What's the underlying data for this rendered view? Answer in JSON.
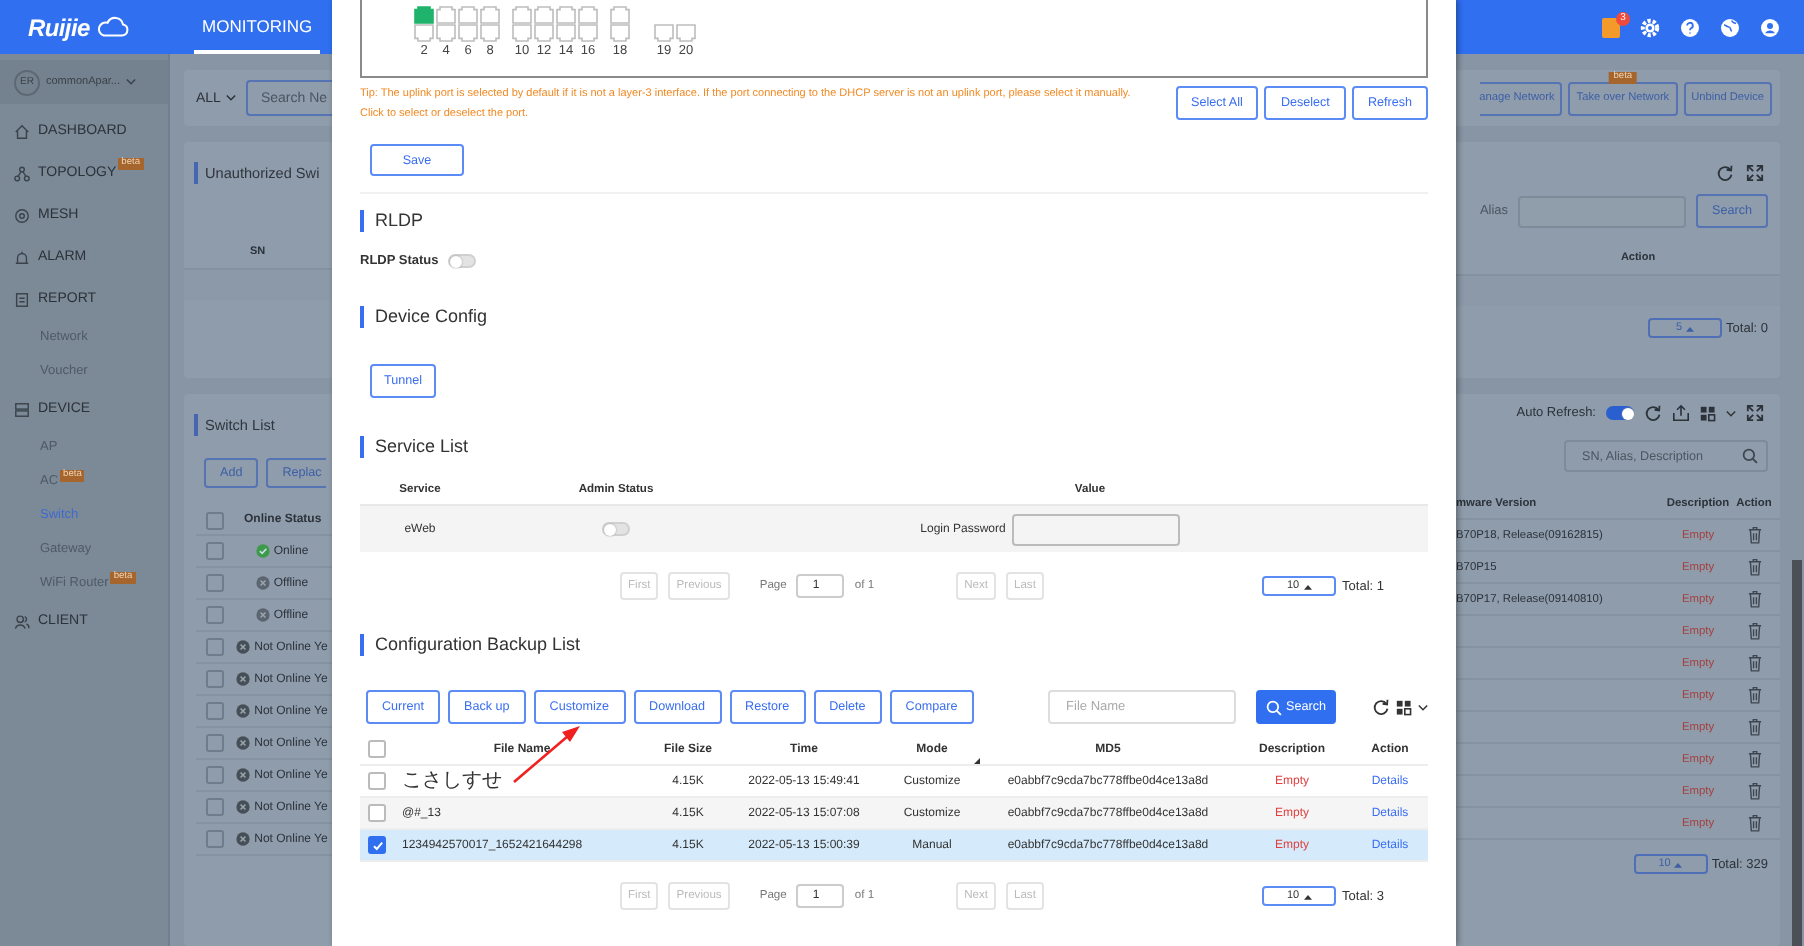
{
  "header": {
    "logo": "Ruijie",
    "tabs": [
      {
        "label": "MONITORING",
        "selected": true
      }
    ],
    "notification_count": "3"
  },
  "sidebar": {
    "account": {
      "initials": "ER",
      "name": "commonApar..."
    },
    "items": [
      {
        "label": "DASHBOARD",
        "kind": "section",
        "selected": false
      },
      {
        "label": "TOPOLOGY",
        "kind": "section",
        "selected": false,
        "badge": "beta"
      },
      {
        "label": "MESH",
        "kind": "section",
        "selected": false
      },
      {
        "label": "ALARM",
        "kind": "section",
        "selected": false
      },
      {
        "label": "REPORT",
        "kind": "section",
        "selected": false
      },
      {
        "label": "Network",
        "kind": "sub",
        "selected": false
      },
      {
        "label": "Voucher",
        "kind": "sub",
        "selected": false
      },
      {
        "label": "DEVICE",
        "kind": "section",
        "selected": false
      },
      {
        "label": "AP",
        "kind": "sub",
        "selected": false
      },
      {
        "label": "AC",
        "kind": "sub",
        "selected": false,
        "badge": "beta"
      },
      {
        "label": "Switch",
        "kind": "sub",
        "selected": true
      },
      {
        "label": "Gateway",
        "kind": "sub",
        "selected": false
      },
      {
        "label": "WiFi Router",
        "kind": "sub",
        "selected": false,
        "badge": "beta"
      },
      {
        "label": "CLIENT",
        "kind": "section",
        "selected": false
      }
    ]
  },
  "filter_bar": {
    "scope": "ALL",
    "search_placeholder": "Search Ne",
    "buttons": [
      {
        "label": "anage Network"
      },
      {
        "label": "Take over Network",
        "badge": "beta"
      },
      {
        "label": "Unbind Device"
      }
    ]
  },
  "unauthorized_switches": {
    "title": "Unauthorized Swi",
    "alias_label": "Alias",
    "search_button": "Search",
    "columns": [
      "SN",
      "Action"
    ],
    "page_size": "5",
    "total": "Total: 0"
  },
  "switch_list": {
    "title": "Switch List",
    "buttons": [
      "Add",
      "Replac"
    ],
    "auto_refresh_label": "Auto Refresh:",
    "auto_refresh": true,
    "search_placeholder": "SN, Alias, Description",
    "all_checked": false,
    "columns": [
      "Online Status",
      "mware Version",
      "Description",
      "Action"
    ],
    "rows": [
      {
        "checked": false,
        "status": "Online",
        "kind": "online",
        "firmware": "B70P18, Release(09162815)",
        "description": "Empty"
      },
      {
        "checked": false,
        "status": "Offline",
        "kind": "offline",
        "firmware": "B70P15",
        "description": "Empty"
      },
      {
        "checked": false,
        "status": "Offline",
        "kind": "offline",
        "firmware": "B70P17, Release(09140810)",
        "description": "Empty"
      },
      {
        "checked": false,
        "status": "Not Online Ye",
        "kind": "never",
        "description": "Empty"
      },
      {
        "checked": false,
        "status": "Not Online Ye",
        "kind": "never",
        "description": "Empty"
      },
      {
        "checked": false,
        "status": "Not Online Ye",
        "kind": "never",
        "description": "Empty"
      },
      {
        "checked": false,
        "status": "Not Online Ye",
        "kind": "never",
        "description": "Empty"
      },
      {
        "checked": false,
        "status": "Not Online Ye",
        "kind": "never",
        "description": "Empty"
      },
      {
        "checked": false,
        "status": "Not Online Ye",
        "kind": "never",
        "description": "Empty"
      },
      {
        "checked": false,
        "status": "Not Online Ye",
        "kind": "never",
        "description": "Empty"
      }
    ],
    "page_size": "10",
    "total": "Total: 329"
  },
  "drawer": {
    "ports": {
      "top": [
        {
          "selected": true
        },
        {
          "selected": false
        },
        {
          "selected": false
        },
        {
          "selected": false
        },
        {
          "selected": false
        },
        {
          "selected": false
        },
        {
          "selected": false
        },
        {
          "selected": false
        },
        {
          "selected": false
        }
      ],
      "bottom": [
        {
          "label": "2",
          "selected": false
        },
        {
          "label": "4",
          "selected": false
        },
        {
          "label": "6",
          "selected": false
        },
        {
          "label": "8",
          "selected": false
        },
        {
          "label": "10",
          "selected": false
        },
        {
          "label": "12",
          "selected": false
        },
        {
          "label": "14",
          "selected": false
        },
        {
          "label": "16",
          "selected": false
        },
        {
          "label": "18",
          "selected": false
        }
      ],
      "sfp": [
        {
          "label": "19",
          "selected": false
        },
        {
          "label": "20",
          "selected": false
        }
      ]
    },
    "tip": [
      "Tip: The uplink port is selected by default if it is not a layer-3 interface. If the port connecting to the DHCP server is not an uplink port, please select it manually.",
      "Click to select or deselect the port."
    ],
    "port_buttons": [
      "Select All",
      "Deselect",
      "Refresh"
    ],
    "save_button": "Save",
    "rldp": {
      "title": "RLDP",
      "status_label": "RLDP Status",
      "on": false
    },
    "device_config": {
      "title": "Device Config",
      "buttons": [
        "Tunnel"
      ]
    },
    "service_list": {
      "title": "Service List",
      "columns": [
        "Service",
        "Admin Status",
        "Value"
      ],
      "rows": [
        {
          "service": "eWeb",
          "on": false,
          "value_label": "Login Password"
        }
      ],
      "pager": {
        "first": "First",
        "previous": "Previous",
        "page_label": "Page",
        "page": "1",
        "of": "of 1",
        "next": "Next",
        "last": "Last",
        "page_size": "10",
        "total": "Total: 1"
      }
    },
    "backup_list": {
      "title": "Configuration Backup List",
      "buttons": [
        "Current",
        "Back up",
        "Customize",
        "Download",
        "Restore",
        "Delete",
        "Compare"
      ],
      "search_placeholder": "File Name",
      "search_button": "Search",
      "all_checked": false,
      "columns": [
        "File Name",
        "File Size",
        "Time",
        "Mode",
        "MD5",
        "Description",
        "Action"
      ],
      "rows": [
        {
          "checked": false,
          "selected": false,
          "file_name": "こさしすせ",
          "size": "4.15K",
          "time": "2022-05-13 15:49:41",
          "mode": "Customize",
          "md5": "e0abbf7c9cda7bc778ffbe0d4ce13a8d",
          "description": "Empty",
          "action": "Details"
        },
        {
          "checked": false,
          "selected": false,
          "file_name": "@#_13",
          "size": "4.15K",
          "time": "2022-05-13 15:07:08",
          "mode": "Customize",
          "md5": "e0abbf7c9cda7bc778ffbe0d4ce13a8d",
          "description": "Empty",
          "action": "Details"
        },
        {
          "checked": true,
          "selected": true,
          "file_name": "1234942570017_1652421644298",
          "size": "4.15K",
          "time": "2022-05-13 15:00:39",
          "mode": "Manual",
          "md5": "e0abbf7c9cda7bc778ffbe0d4ce13a8d",
          "description": "Empty",
          "action": "Details"
        }
      ],
      "pager": {
        "first": "First",
        "previous": "Previous",
        "page_label": "Page",
        "page": "1",
        "of": "of 1",
        "next": "Next",
        "last": "Last",
        "page_size": "10",
        "total": "Total: 3"
      }
    }
  }
}
